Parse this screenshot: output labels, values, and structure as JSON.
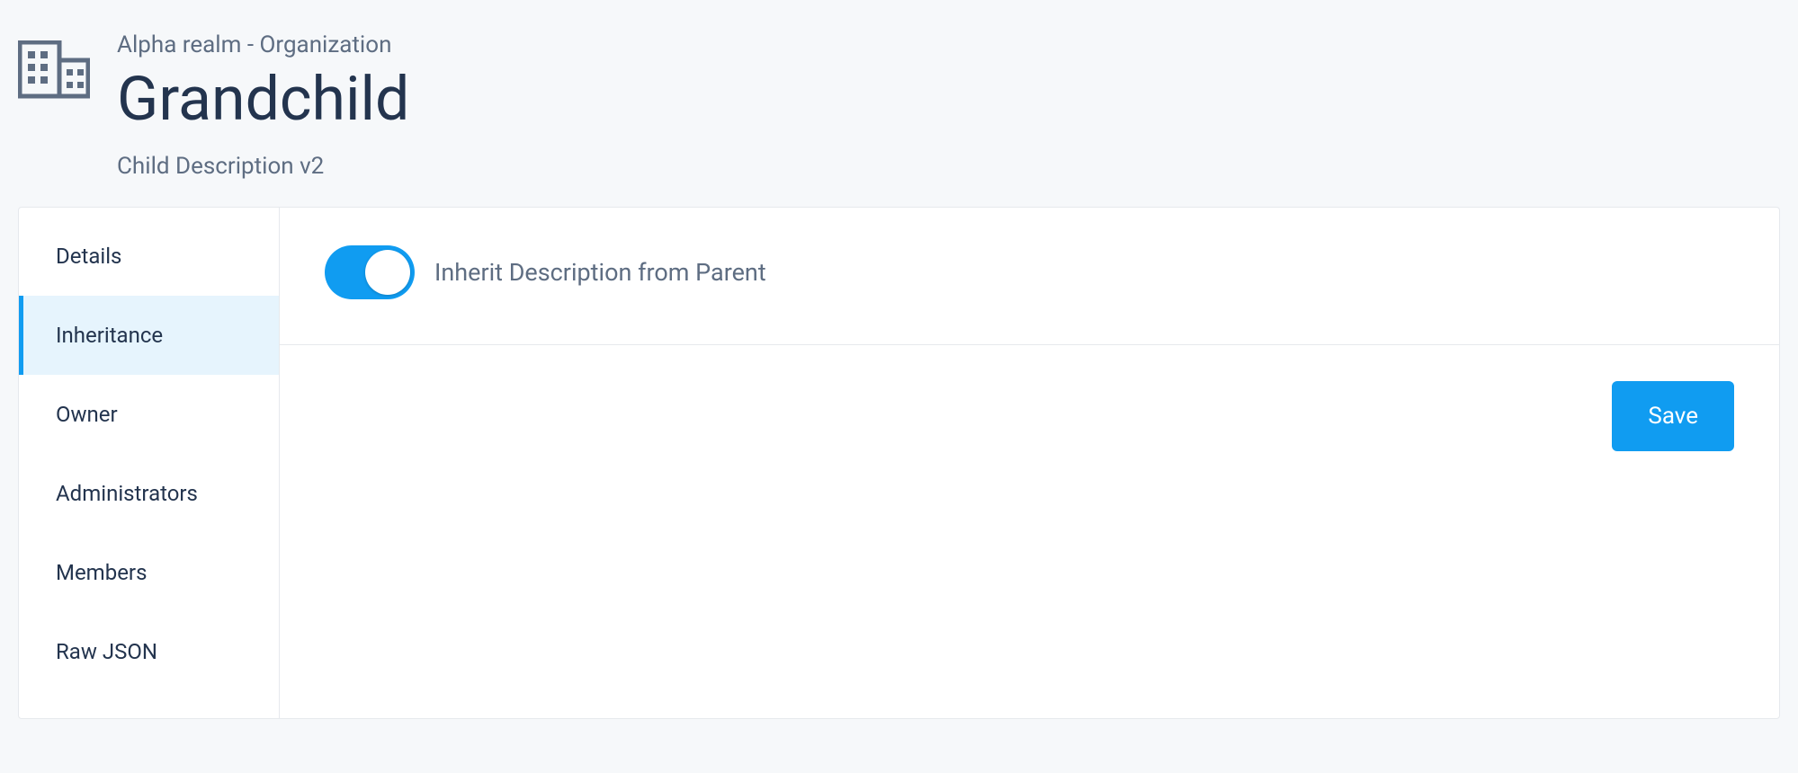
{
  "header": {
    "breadcrumb": "Alpha realm - Organization",
    "title": "Grandchild",
    "subtitle": "Child Description v2"
  },
  "sidebar": {
    "items": [
      {
        "label": "Details",
        "active": false
      },
      {
        "label": "Inheritance",
        "active": true
      },
      {
        "label": "Owner",
        "active": false
      },
      {
        "label": "Administrators",
        "active": false
      },
      {
        "label": "Members",
        "active": false
      },
      {
        "label": "Raw JSON",
        "active": false
      }
    ]
  },
  "main": {
    "toggle": {
      "label": "Inherit Description from Parent",
      "enabled": true
    },
    "save_label": "Save"
  }
}
